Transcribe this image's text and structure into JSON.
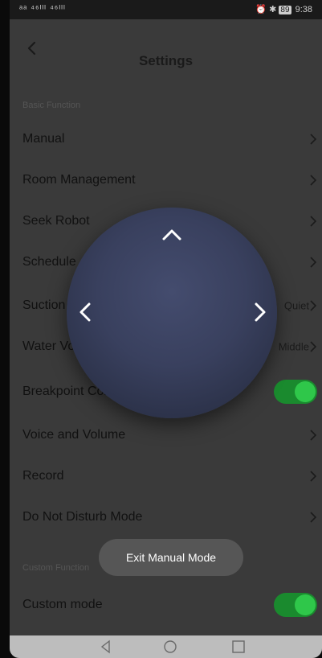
{
  "status_bar": {
    "signal_text": "ᵃᵃ ⁴⁶ᴵᴵᴵ ⁴⁶ᴵᴵᴵ",
    "battery": "89",
    "time": "9:38"
  },
  "header": {
    "back_icon": "chevron-left-icon",
    "title": "Settings"
  },
  "sections": {
    "basic_label": "Basic Function",
    "custom_label": "Custom Function"
  },
  "rows": [
    {
      "label": "Manual",
      "value": "",
      "control": "chevron"
    },
    {
      "label": "Room Management",
      "value": "",
      "control": "chevron"
    },
    {
      "label": "Seek Robot",
      "value": "",
      "control": "chevron"
    },
    {
      "label": "Schedule",
      "value": "",
      "control": "chevron"
    },
    {
      "label": "Suction",
      "value": "Quiet",
      "control": "chevron"
    },
    {
      "label": "Water Volume",
      "value": "Middle",
      "control": "chevron"
    },
    {
      "label": "Breakpoint Continue Sweeping",
      "value": "",
      "control": "toggle",
      "state": "on"
    },
    {
      "label": "Voice and Volume",
      "value": "",
      "control": "chevron"
    },
    {
      "label": "Record",
      "value": "",
      "control": "chevron"
    },
    {
      "label": "Do Not Disturb Mode",
      "value": "",
      "control": "chevron"
    }
  ],
  "custom_rows": [
    {
      "label": "Custom mode",
      "control": "toggle",
      "state": "on"
    }
  ],
  "joystick": {
    "up_icon": "chevron-up-icon",
    "left_icon": "chevron-left-icon",
    "right_icon": "chevron-right-icon",
    "color": "#3a415f"
  },
  "toast": {
    "text": "Exit Manual Mode"
  },
  "nav_bar": {
    "back_icon": "triangle-back-icon",
    "home_icon": "circle-home-icon",
    "recent_icon": "square-recents-icon"
  },
  "colors": {
    "toggle_on": "#2fc74a",
    "overlay": "#3a3a3a"
  }
}
